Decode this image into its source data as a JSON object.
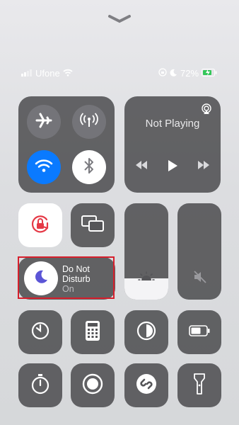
{
  "status_bar": {
    "carrier": "Ufone",
    "battery": "72%"
  },
  "now_playing": {
    "label": "Not Playing"
  },
  "do_not_disturb": {
    "title_line1": "Do Not",
    "title_line2": "Disturb",
    "state": "On"
  },
  "sliders": {
    "brightness_level": 0.22,
    "volume_level": 0.0
  },
  "colors": {
    "wifi_active": "#0a7aff",
    "dnd_moon": "#5b55d6",
    "rotation_lock": "#e53946",
    "battery_charging": "#34c759",
    "highlight_border": "#d61f2c"
  }
}
